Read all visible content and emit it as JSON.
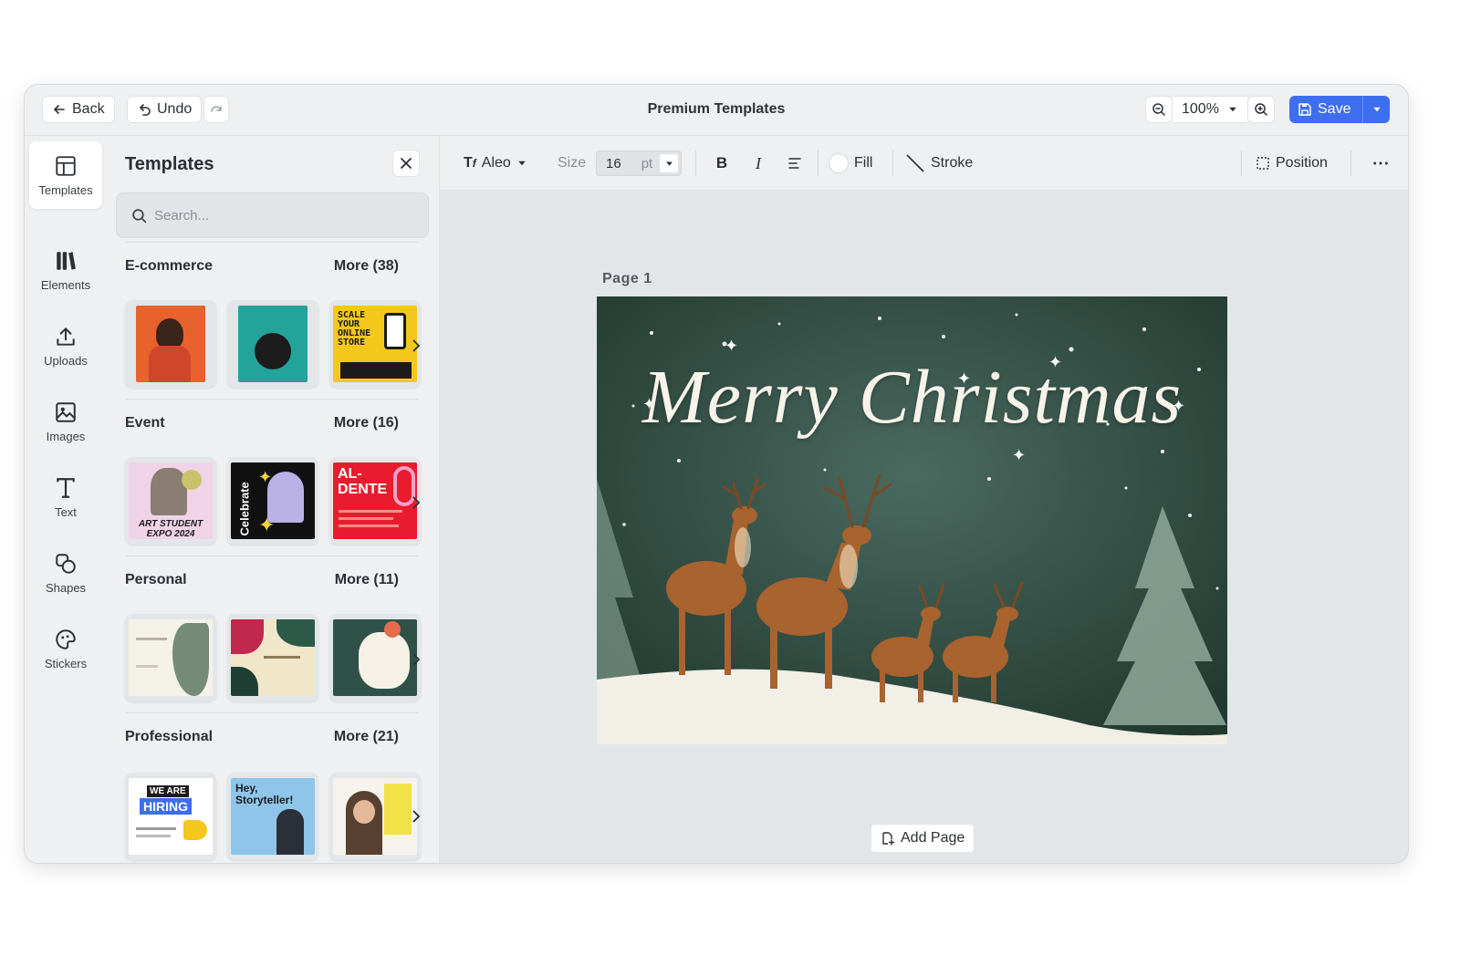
{
  "topbar": {
    "back_label": "Back",
    "undo_label": "Undo",
    "title": "Premium Templates",
    "zoom_value": "100%",
    "save_label": "Save"
  },
  "rail": {
    "items": [
      {
        "label": "Templates",
        "icon": "templates-icon"
      },
      {
        "label": "Elements",
        "icon": "elements-icon"
      },
      {
        "label": "Uploads",
        "icon": "upload-icon"
      },
      {
        "label": "Images",
        "icon": "image-icon"
      },
      {
        "label": "Text",
        "icon": "text-icon"
      },
      {
        "label": "Shapes",
        "icon": "shapes-icon"
      },
      {
        "label": "Stickers",
        "icon": "sticker-icon"
      }
    ]
  },
  "panel": {
    "title": "Templates",
    "search_placeholder": "Search...",
    "categories": [
      {
        "name": "E-commerce",
        "more": "More (38)"
      },
      {
        "name": "Event",
        "more": "More (16)"
      },
      {
        "name": "Personal",
        "more": "More (11)"
      },
      {
        "name": "Professional",
        "more": "More (21)"
      }
    ],
    "thumb_text": {
      "ecom_3": "SCALE YOUR ONLINE STORE",
      "event_1": "ART STUDENT EXPO 2024",
      "event_2": "Celebrate",
      "event_3": "AL-DENTE",
      "prof_1_a": "WE ARE",
      "prof_1_b": "HIRING",
      "prof_2": "Hey, Storyteller!"
    }
  },
  "props": {
    "font_name": "Aleo",
    "size_label": "Size",
    "size_value": "16",
    "size_unit": "pt",
    "fill_label": "Fill",
    "stroke_label": "Stroke",
    "position_label": "Position"
  },
  "canvas": {
    "page_label": "Page  1",
    "card_text": "Merry Christmas",
    "add_page_label": "Add Page"
  },
  "colors": {
    "accent": "#3e6ef0",
    "card_bg": "#2f4a43",
    "snow": "#f2efe7",
    "deer": "#a8632f"
  }
}
